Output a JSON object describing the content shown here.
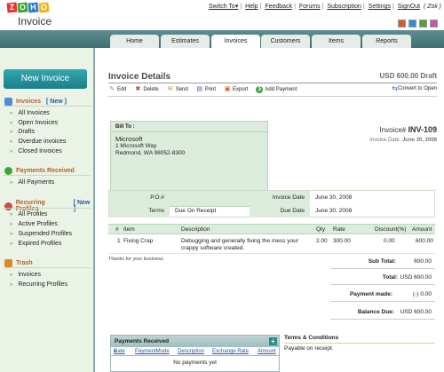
{
  "header": {
    "logo_letters": [
      "Z",
      "O",
      "H",
      "O"
    ],
    "product_name": "Invoice",
    "links": [
      "Switch To",
      "Help",
      "Feedback",
      "Forums",
      "Subscription",
      "Settings",
      "SignOut"
    ],
    "switch_arrow": "▾",
    "user": "( Zoii )",
    "swatch_colors": [
      "#d35a2a",
      "#3a8ac8",
      "#5a9e3a",
      "#c25aa8"
    ]
  },
  "tabs": [
    "Home",
    "Estimates",
    "Invoices",
    "Customers",
    "Items",
    "Reports"
  ],
  "active_tab": "Invoices",
  "sidebar": {
    "new_invoice_label": "New Invoice",
    "invoices": {
      "title": "Invoices",
      "new_link": "[ New ]",
      "items": [
        "All Invoices",
        "Open Invoices",
        "Drafts",
        "Overdue invoices",
        "Closed Invoices"
      ]
    },
    "payments": {
      "title": "Payments Received",
      "items": [
        "All Payments"
      ]
    },
    "recurring": {
      "title": "Recurring Profiles",
      "new_link": "[ New ]",
      "items": [
        "All Profiles",
        "Active Profiles",
        "Suspended Profiles",
        "Expired Profiles"
      ]
    },
    "trash": {
      "title": "Trash",
      "items": [
        "Invoices",
        "Recurring Profiles"
      ]
    }
  },
  "invoice": {
    "page_title": "Invoice Details",
    "amount_status": "USD 600.00  Draft",
    "toolbar": [
      "Edit",
      "Delete",
      "Send",
      "Print",
      "Export",
      "Add Payment"
    ],
    "convert_label": "Convert to Open",
    "number_label": "Invoice#",
    "number": "INV-109",
    "date_label": "Invoice Date:",
    "date": "June 30, 2008",
    "bill_to_label": "Bill To :",
    "bill_to": {
      "company": "Microsoft",
      "line1": "1 Microsoft Way",
      "line2": "Redmond, WA 98052-8300"
    },
    "po_label": "P.O.#",
    "po_value": "",
    "terms_label": "Terms",
    "terms_value": "Due On Receipt",
    "invoice_date_label": "Invoice Date",
    "invoice_date_value": "June 30, 2008",
    "due_date_label": "Due Date",
    "due_date_value": "June 30, 2008",
    "item_columns": [
      "#",
      "Item",
      "Description",
      "Qty",
      "Rate",
      "Discount(%)",
      "Amount"
    ],
    "items": [
      {
        "num": "1",
        "item": "Fixing Crap",
        "description": "Debugging and generally fixing the mess your crappy software created.",
        "qty": "2.00",
        "rate": "300.00",
        "discount": "0.00",
        "amount": "600.00"
      }
    ],
    "notes": "Thanks for your business.",
    "subtotal_label": "Sub Total:",
    "subtotal": "600.00",
    "total_label": "Total:",
    "total": "USD 600.00",
    "payment_made_label": "Payment made:",
    "payment_made": "(-) 0.00",
    "balance_due_label": "Balance Due:",
    "balance_due": "USD 600.00"
  },
  "payments_received": {
    "title": "Payments Received",
    "columns": [
      "Date",
      "PaymentMode",
      "Description",
      "Exchange Rate",
      "Amount"
    ],
    "empty": "No payments yet"
  },
  "terms_conditions": {
    "title": "Terms & Conditions",
    "body": "Payable on receipt."
  }
}
